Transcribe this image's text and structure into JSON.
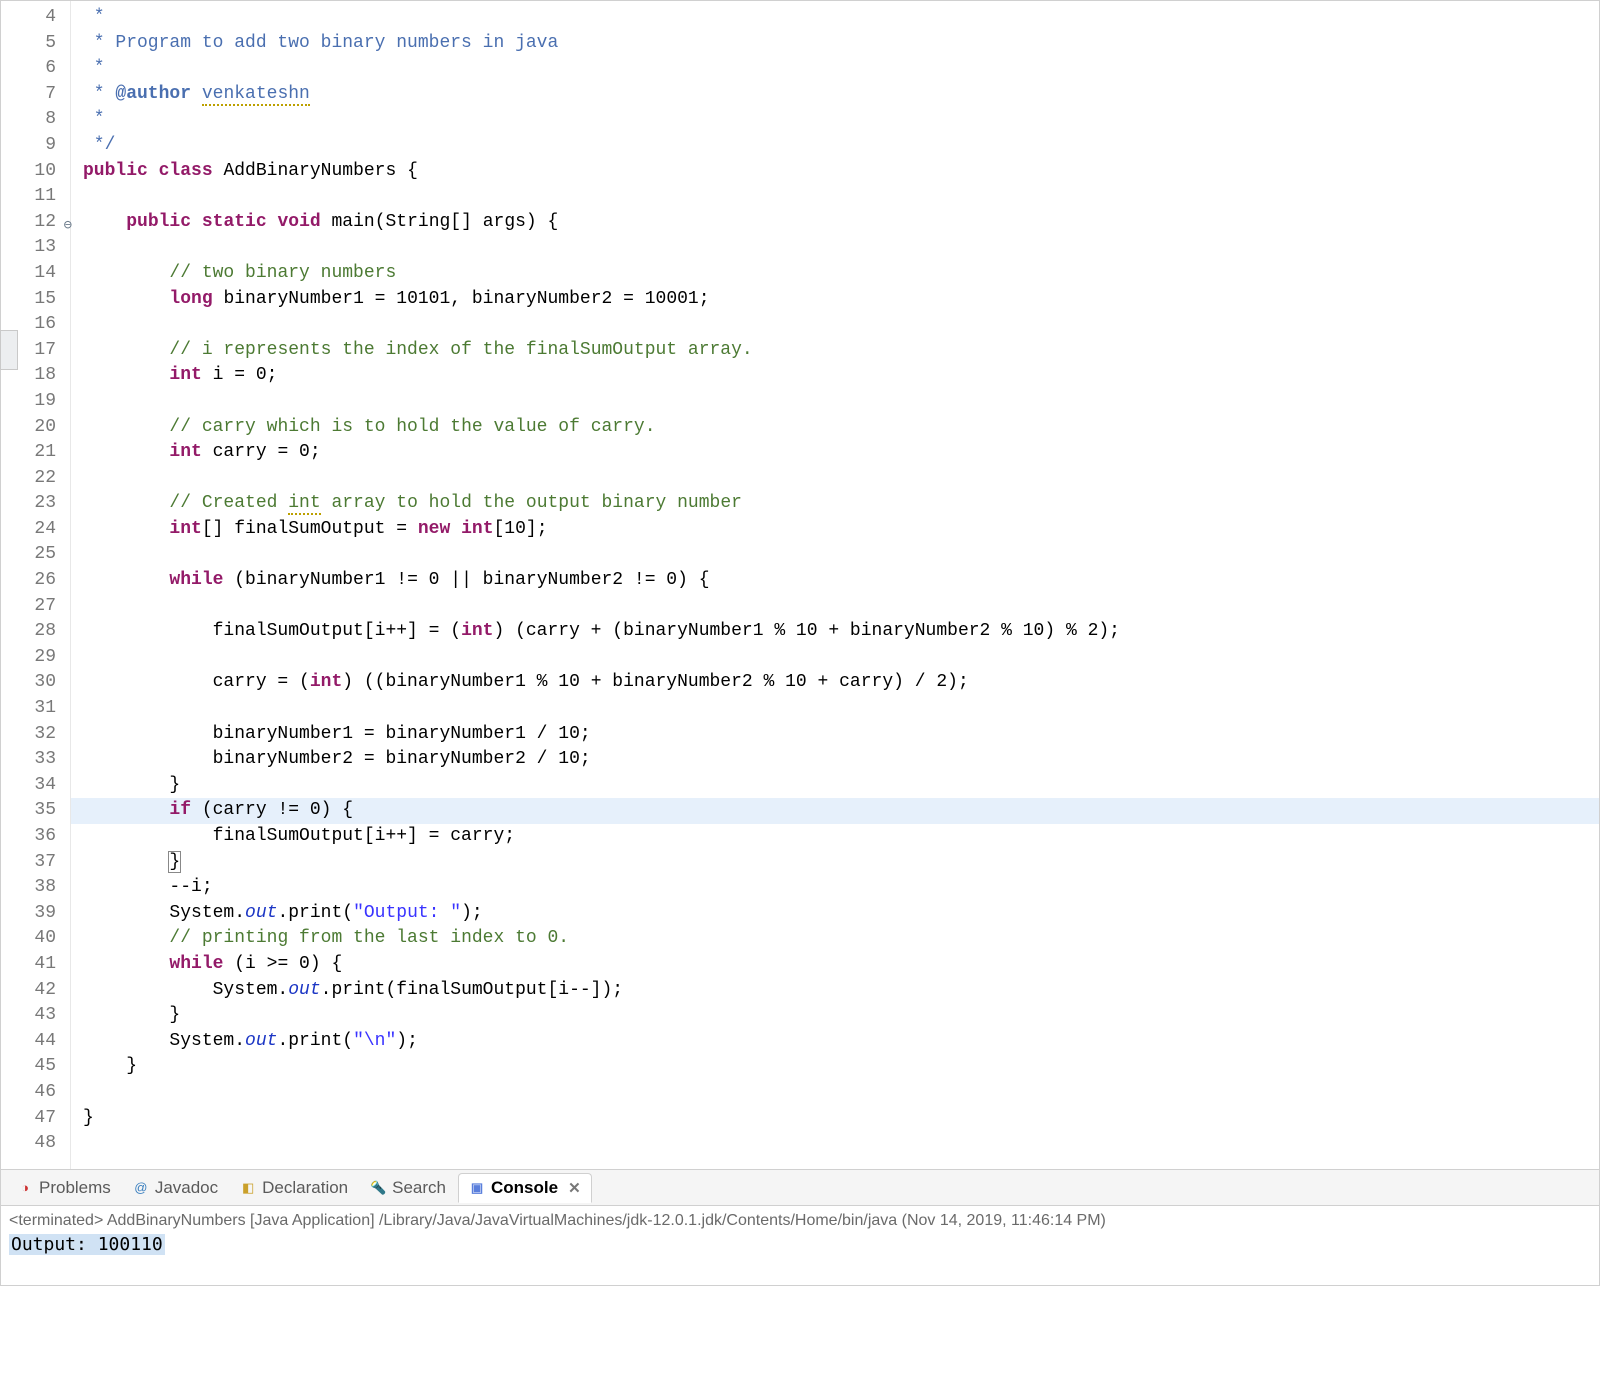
{
  "editor": {
    "lines": [
      {
        "n": "4",
        "tokens": [
          {
            "cls": "docc",
            "t": " *"
          }
        ]
      },
      {
        "n": "5",
        "tokens": [
          {
            "cls": "docc",
            "t": " * Program to add two binary numbers in java"
          }
        ]
      },
      {
        "n": "6",
        "tokens": [
          {
            "cls": "docc",
            "t": " *"
          }
        ]
      },
      {
        "n": "7",
        "tokens": [
          {
            "cls": "docc",
            "t": " * "
          },
          {
            "cls": "doct",
            "t": "@author"
          },
          {
            "cls": "docc",
            "t": " "
          },
          {
            "cls": "docc squig",
            "t": "venkateshn"
          }
        ]
      },
      {
        "n": "8",
        "tokens": [
          {
            "cls": "docc",
            "t": " *"
          }
        ]
      },
      {
        "n": "9",
        "tokens": [
          {
            "cls": "docc",
            "t": " */"
          }
        ]
      },
      {
        "n": "10",
        "tokens": [
          {
            "cls": "kw",
            "t": "public"
          },
          {
            "t": " "
          },
          {
            "cls": "kw",
            "t": "class"
          },
          {
            "t": " AddBinaryNumbers {"
          }
        ]
      },
      {
        "n": "11",
        "tokens": []
      },
      {
        "n": "12",
        "fold": true,
        "tokens": [
          {
            "t": "    "
          },
          {
            "cls": "kw",
            "t": "public"
          },
          {
            "t": " "
          },
          {
            "cls": "kw",
            "t": "static"
          },
          {
            "t": " "
          },
          {
            "cls": "kw",
            "t": "void"
          },
          {
            "t": " main(String[] args) {"
          }
        ]
      },
      {
        "n": "13",
        "tokens": []
      },
      {
        "n": "14",
        "tokens": [
          {
            "t": "        "
          },
          {
            "cls": "comment",
            "t": "// two binary numbers"
          }
        ]
      },
      {
        "n": "15",
        "tokens": [
          {
            "t": "        "
          },
          {
            "cls": "kw",
            "t": "long"
          },
          {
            "t": " binaryNumber1 = 10101, binaryNumber2 = 10001;"
          }
        ]
      },
      {
        "n": "16",
        "tokens": []
      },
      {
        "n": "17",
        "tokens": [
          {
            "t": "        "
          },
          {
            "cls": "comment",
            "t": "// i represents the index of the finalSumOutput array."
          }
        ]
      },
      {
        "n": "18",
        "tokens": [
          {
            "t": "        "
          },
          {
            "cls": "kw",
            "t": "int"
          },
          {
            "t": " i = 0;"
          }
        ]
      },
      {
        "n": "19",
        "tokens": []
      },
      {
        "n": "20",
        "tokens": [
          {
            "t": "        "
          },
          {
            "cls": "comment",
            "t": "// carry which is to hold the value of carry."
          }
        ]
      },
      {
        "n": "21",
        "tokens": [
          {
            "t": "        "
          },
          {
            "cls": "kw",
            "t": "int"
          },
          {
            "t": " carry = 0;"
          }
        ]
      },
      {
        "n": "22",
        "tokens": []
      },
      {
        "n": "23",
        "tokens": [
          {
            "t": "        "
          },
          {
            "cls": "comment",
            "t": "// Created "
          },
          {
            "cls": "comment squig",
            "t": "int"
          },
          {
            "cls": "comment",
            "t": " array to hold the output binary number"
          }
        ]
      },
      {
        "n": "24",
        "tokens": [
          {
            "t": "        "
          },
          {
            "cls": "kw",
            "t": "int"
          },
          {
            "t": "[] finalSumOutput = "
          },
          {
            "cls": "kw",
            "t": "new"
          },
          {
            "t": " "
          },
          {
            "cls": "kw",
            "t": "int"
          },
          {
            "t": "[10];"
          }
        ]
      },
      {
        "n": "25",
        "tokens": []
      },
      {
        "n": "26",
        "tokens": [
          {
            "t": "        "
          },
          {
            "cls": "kw",
            "t": "while"
          },
          {
            "t": " (binaryNumber1 != 0 || binaryNumber2 != 0) {"
          }
        ]
      },
      {
        "n": "27",
        "tokens": []
      },
      {
        "n": "28",
        "tokens": [
          {
            "t": "            finalSumOutput[i++] = ("
          },
          {
            "cls": "kw",
            "t": "int"
          },
          {
            "t": ") (carry + (binaryNumber1 % 10 + binaryNumber2 % 10) % 2);"
          }
        ]
      },
      {
        "n": "29",
        "tokens": []
      },
      {
        "n": "30",
        "tokens": [
          {
            "t": "            carry = ("
          },
          {
            "cls": "kw",
            "t": "int"
          },
          {
            "t": ") ((binaryNumber1 % 10 + binaryNumber2 % 10 + carry) / 2);"
          }
        ]
      },
      {
        "n": "31",
        "tokens": []
      },
      {
        "n": "32",
        "tokens": [
          {
            "t": "            binaryNumber1 = binaryNumber1 / 10;"
          }
        ]
      },
      {
        "n": "33",
        "tokens": [
          {
            "t": "            binaryNumber2 = binaryNumber2 / 10;"
          }
        ]
      },
      {
        "n": "34",
        "tokens": [
          {
            "t": "        }"
          }
        ]
      },
      {
        "n": "35",
        "hl": true,
        "tokens": [
          {
            "t": "        "
          },
          {
            "cls": "kw",
            "t": "if"
          },
          {
            "t": " (carry != 0) {"
          }
        ]
      },
      {
        "n": "36",
        "tokens": [
          {
            "t": "            finalSumOutput[i++] = carry;"
          }
        ]
      },
      {
        "n": "37",
        "tokens": [
          {
            "t": "        "
          },
          {
            "cls": "box",
            "t": "}"
          }
        ]
      },
      {
        "n": "38",
        "tokens": [
          {
            "t": "        --i;"
          }
        ]
      },
      {
        "n": "39",
        "tokens": [
          {
            "t": "        System."
          },
          {
            "cls": "field",
            "t": "out"
          },
          {
            "t": ".print("
          },
          {
            "cls": "str",
            "t": "\"Output: \""
          },
          {
            "t": ");"
          }
        ]
      },
      {
        "n": "40",
        "tokens": [
          {
            "t": "        "
          },
          {
            "cls": "comment",
            "t": "// printing from the last index to 0."
          }
        ]
      },
      {
        "n": "41",
        "tokens": [
          {
            "t": "        "
          },
          {
            "cls": "kw",
            "t": "while"
          },
          {
            "t": " (i >= 0) {"
          }
        ]
      },
      {
        "n": "42",
        "tokens": [
          {
            "t": "            System."
          },
          {
            "cls": "field",
            "t": "out"
          },
          {
            "t": ".print(finalSumOutput[i--]);"
          }
        ]
      },
      {
        "n": "43",
        "tokens": [
          {
            "t": "        }"
          }
        ]
      },
      {
        "n": "44",
        "tokens": [
          {
            "t": "        System."
          },
          {
            "cls": "field",
            "t": "out"
          },
          {
            "t": ".print("
          },
          {
            "cls": "str",
            "t": "\"\\n\""
          },
          {
            "t": ");"
          }
        ]
      },
      {
        "n": "45",
        "tokens": [
          {
            "t": "    }"
          }
        ]
      },
      {
        "n": "46",
        "tokens": []
      },
      {
        "n": "47",
        "tokens": [
          {
            "t": "}"
          }
        ]
      },
      {
        "n": "48",
        "tokens": []
      }
    ]
  },
  "tabs": {
    "problems": "Problems",
    "javadoc": "Javadoc",
    "declaration": "Declaration",
    "search": "Search",
    "console": "Console"
  },
  "console": {
    "meta": "<terminated> AddBinaryNumbers [Java Application] /Library/Java/JavaVirtualMachines/jdk-12.0.1.jdk/Contents/Home/bin/java (Nov 14, 2019, 11:46:14 PM)",
    "output": "Output: 100110"
  }
}
